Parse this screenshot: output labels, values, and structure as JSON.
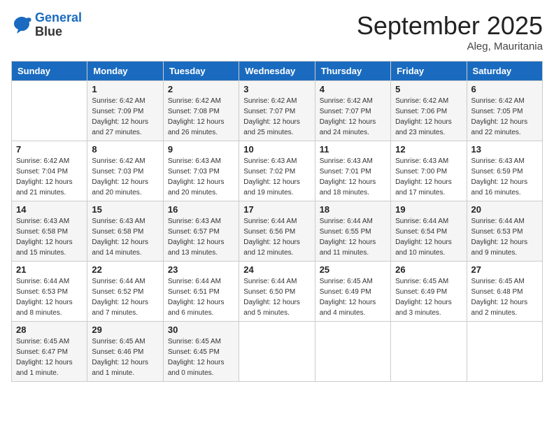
{
  "logo": {
    "line1": "General",
    "line2": "Blue"
  },
  "title": "September 2025",
  "location": "Aleg, Mauritania",
  "days_of_week": [
    "Sunday",
    "Monday",
    "Tuesday",
    "Wednesday",
    "Thursday",
    "Friday",
    "Saturday"
  ],
  "weeks": [
    [
      {
        "day": "",
        "info": ""
      },
      {
        "day": "1",
        "info": "Sunrise: 6:42 AM\nSunset: 7:09 PM\nDaylight: 12 hours\nand 27 minutes."
      },
      {
        "day": "2",
        "info": "Sunrise: 6:42 AM\nSunset: 7:08 PM\nDaylight: 12 hours\nand 26 minutes."
      },
      {
        "day": "3",
        "info": "Sunrise: 6:42 AM\nSunset: 7:07 PM\nDaylight: 12 hours\nand 25 minutes."
      },
      {
        "day": "4",
        "info": "Sunrise: 6:42 AM\nSunset: 7:07 PM\nDaylight: 12 hours\nand 24 minutes."
      },
      {
        "day": "5",
        "info": "Sunrise: 6:42 AM\nSunset: 7:06 PM\nDaylight: 12 hours\nand 23 minutes."
      },
      {
        "day": "6",
        "info": "Sunrise: 6:42 AM\nSunset: 7:05 PM\nDaylight: 12 hours\nand 22 minutes."
      }
    ],
    [
      {
        "day": "7",
        "info": "Sunrise: 6:42 AM\nSunset: 7:04 PM\nDaylight: 12 hours\nand 21 minutes."
      },
      {
        "day": "8",
        "info": "Sunrise: 6:42 AM\nSunset: 7:03 PM\nDaylight: 12 hours\nand 20 minutes."
      },
      {
        "day": "9",
        "info": "Sunrise: 6:43 AM\nSunset: 7:03 PM\nDaylight: 12 hours\nand 20 minutes."
      },
      {
        "day": "10",
        "info": "Sunrise: 6:43 AM\nSunset: 7:02 PM\nDaylight: 12 hours\nand 19 minutes."
      },
      {
        "day": "11",
        "info": "Sunrise: 6:43 AM\nSunset: 7:01 PM\nDaylight: 12 hours\nand 18 minutes."
      },
      {
        "day": "12",
        "info": "Sunrise: 6:43 AM\nSunset: 7:00 PM\nDaylight: 12 hours\nand 17 minutes."
      },
      {
        "day": "13",
        "info": "Sunrise: 6:43 AM\nSunset: 6:59 PM\nDaylight: 12 hours\nand 16 minutes."
      }
    ],
    [
      {
        "day": "14",
        "info": "Sunrise: 6:43 AM\nSunset: 6:58 PM\nDaylight: 12 hours\nand 15 minutes."
      },
      {
        "day": "15",
        "info": "Sunrise: 6:43 AM\nSunset: 6:58 PM\nDaylight: 12 hours\nand 14 minutes."
      },
      {
        "day": "16",
        "info": "Sunrise: 6:43 AM\nSunset: 6:57 PM\nDaylight: 12 hours\nand 13 minutes."
      },
      {
        "day": "17",
        "info": "Sunrise: 6:44 AM\nSunset: 6:56 PM\nDaylight: 12 hours\nand 12 minutes."
      },
      {
        "day": "18",
        "info": "Sunrise: 6:44 AM\nSunset: 6:55 PM\nDaylight: 12 hours\nand 11 minutes."
      },
      {
        "day": "19",
        "info": "Sunrise: 6:44 AM\nSunset: 6:54 PM\nDaylight: 12 hours\nand 10 minutes."
      },
      {
        "day": "20",
        "info": "Sunrise: 6:44 AM\nSunset: 6:53 PM\nDaylight: 12 hours\nand 9 minutes."
      }
    ],
    [
      {
        "day": "21",
        "info": "Sunrise: 6:44 AM\nSunset: 6:53 PM\nDaylight: 12 hours\nand 8 minutes."
      },
      {
        "day": "22",
        "info": "Sunrise: 6:44 AM\nSunset: 6:52 PM\nDaylight: 12 hours\nand 7 minutes."
      },
      {
        "day": "23",
        "info": "Sunrise: 6:44 AM\nSunset: 6:51 PM\nDaylight: 12 hours\nand 6 minutes."
      },
      {
        "day": "24",
        "info": "Sunrise: 6:44 AM\nSunset: 6:50 PM\nDaylight: 12 hours\nand 5 minutes."
      },
      {
        "day": "25",
        "info": "Sunrise: 6:45 AM\nSunset: 6:49 PM\nDaylight: 12 hours\nand 4 minutes."
      },
      {
        "day": "26",
        "info": "Sunrise: 6:45 AM\nSunset: 6:49 PM\nDaylight: 12 hours\nand 3 minutes."
      },
      {
        "day": "27",
        "info": "Sunrise: 6:45 AM\nSunset: 6:48 PM\nDaylight: 12 hours\nand 2 minutes."
      }
    ],
    [
      {
        "day": "28",
        "info": "Sunrise: 6:45 AM\nSunset: 6:47 PM\nDaylight: 12 hours\nand 1 minute."
      },
      {
        "day": "29",
        "info": "Sunrise: 6:45 AM\nSunset: 6:46 PM\nDaylight: 12 hours\nand 1 minute."
      },
      {
        "day": "30",
        "info": "Sunrise: 6:45 AM\nSunset: 6:45 PM\nDaylight: 12 hours\nand 0 minutes."
      },
      {
        "day": "",
        "info": ""
      },
      {
        "day": "",
        "info": ""
      },
      {
        "day": "",
        "info": ""
      },
      {
        "day": "",
        "info": ""
      }
    ]
  ]
}
